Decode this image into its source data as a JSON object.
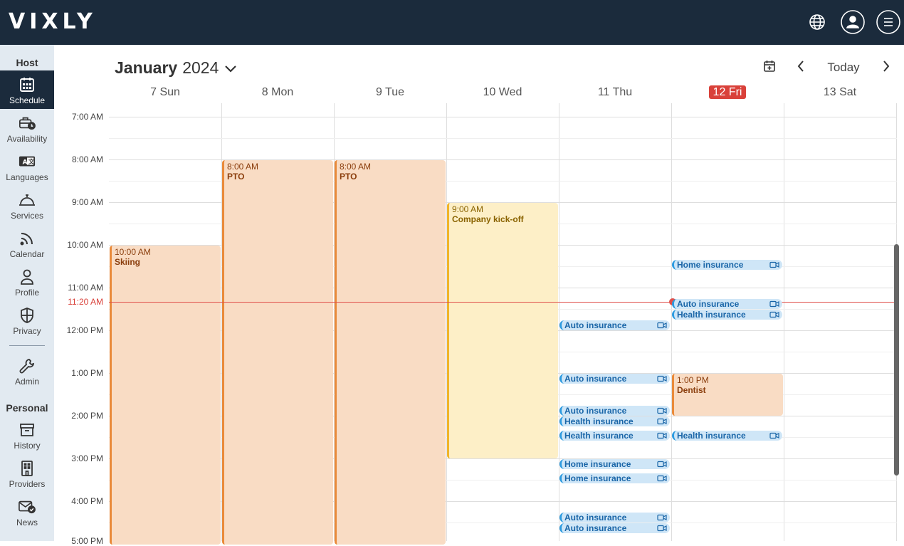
{
  "brand": {
    "logo": "VIXLY"
  },
  "topbar": {
    "icons": [
      "globe-icon",
      "user-icon",
      "menu-icon"
    ]
  },
  "sidebar": {
    "host_heading": "Host",
    "personal_heading": "Personal",
    "items": [
      {
        "label": "Schedule",
        "icon": "calendar-grid-icon",
        "active": true
      },
      {
        "label": "Availability",
        "icon": "briefcase-clock-icon"
      },
      {
        "label": "Languages",
        "icon": "translate-icon"
      },
      {
        "label": "Services",
        "icon": "service-bell-icon"
      },
      {
        "label": "Calendar",
        "icon": "rss-feed-icon"
      },
      {
        "label": "Profile",
        "icon": "person-icon"
      },
      {
        "label": "Privacy",
        "icon": "shield-icon"
      },
      {
        "label": "Admin",
        "icon": "wrench-icon"
      },
      {
        "label": "History",
        "icon": "archive-box-icon"
      },
      {
        "label": "Providers",
        "icon": "building-icon"
      },
      {
        "label": "News",
        "icon": "mail-check-icon"
      }
    ]
  },
  "header": {
    "month": "January",
    "year": "2024",
    "today_label": "Today"
  },
  "days": [
    {
      "label": "7 Sun"
    },
    {
      "label": "8 Mon"
    },
    {
      "label": "9 Tue"
    },
    {
      "label": "10 Wed"
    },
    {
      "label": "11 Thu"
    },
    {
      "label": "12 Fri",
      "today": true
    },
    {
      "label": "13 Sat"
    }
  ],
  "times": [
    "7:00 AM",
    "8:00 AM",
    "9:00 AM",
    "10:00 AM",
    "11:00 AM",
    "12:00 PM",
    "1:00 PM",
    "2:00 PM",
    "3:00 PM",
    "4:00 PM",
    "5:00 PM"
  ],
  "now_label": "11:20 AM",
  "colors": {
    "accent_today": "#d9413a",
    "topbar": "#1b2b3c",
    "sidebar": "#e2eaf1",
    "event_orange": "#f9dcc4",
    "event_yellow": "#fdefc7",
    "event_blue": "#cfe6f7"
  },
  "events": {
    "skiing": {
      "time": "10:00 AM",
      "name": "Skiing"
    },
    "pto_mon": {
      "time": "8:00 AM",
      "name": "PTO"
    },
    "pto_tue": {
      "time": "8:00 AM",
      "name": "PTO"
    },
    "kickoff": {
      "time": "9:00 AM",
      "name": "Company kick-off"
    },
    "dentist": {
      "time": "1:00 PM",
      "name": "Dentist"
    },
    "thu": [
      "Auto insurance",
      "Auto insurance",
      "Auto insurance",
      "Health insurance",
      "Health insurance",
      "Home insurance",
      "Home insurance",
      "Auto insurance",
      "Auto insurance"
    ],
    "fri": [
      "Home insurance",
      "Auto insurance",
      "Health insurance",
      "Health insurance"
    ]
  }
}
